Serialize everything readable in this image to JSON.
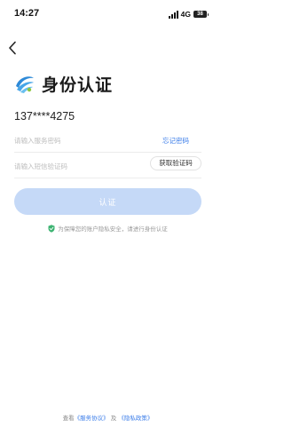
{
  "status_bar": {
    "time": "14:27",
    "network": "4G",
    "battery": "38"
  },
  "brand": {
    "logo": "china-mobile-logo",
    "title": "身份认证"
  },
  "phone": {
    "masked_number": "137****4275"
  },
  "password_field": {
    "placeholder": "请输入服务密码",
    "value": "",
    "forgot_label": "忘记密码"
  },
  "code_field": {
    "placeholder": "请输入短信验证码",
    "value": "",
    "get_code_label": "获取验证码"
  },
  "submit": {
    "label": "认证"
  },
  "privacy": {
    "icon": "shield-check-icon",
    "text": "为保障您的账户隐私安全，请进行身份认证"
  },
  "footer": {
    "prefix": "查看",
    "service_agreement": "《服务协议》",
    "and": "及",
    "privacy_policy": "《隐私政策》"
  },
  "colors": {
    "accent": "#3b7de9",
    "button_disabled": "#c5d9f7",
    "logo_blue": "#2e8ad8",
    "shield_green": "#3cb371"
  }
}
